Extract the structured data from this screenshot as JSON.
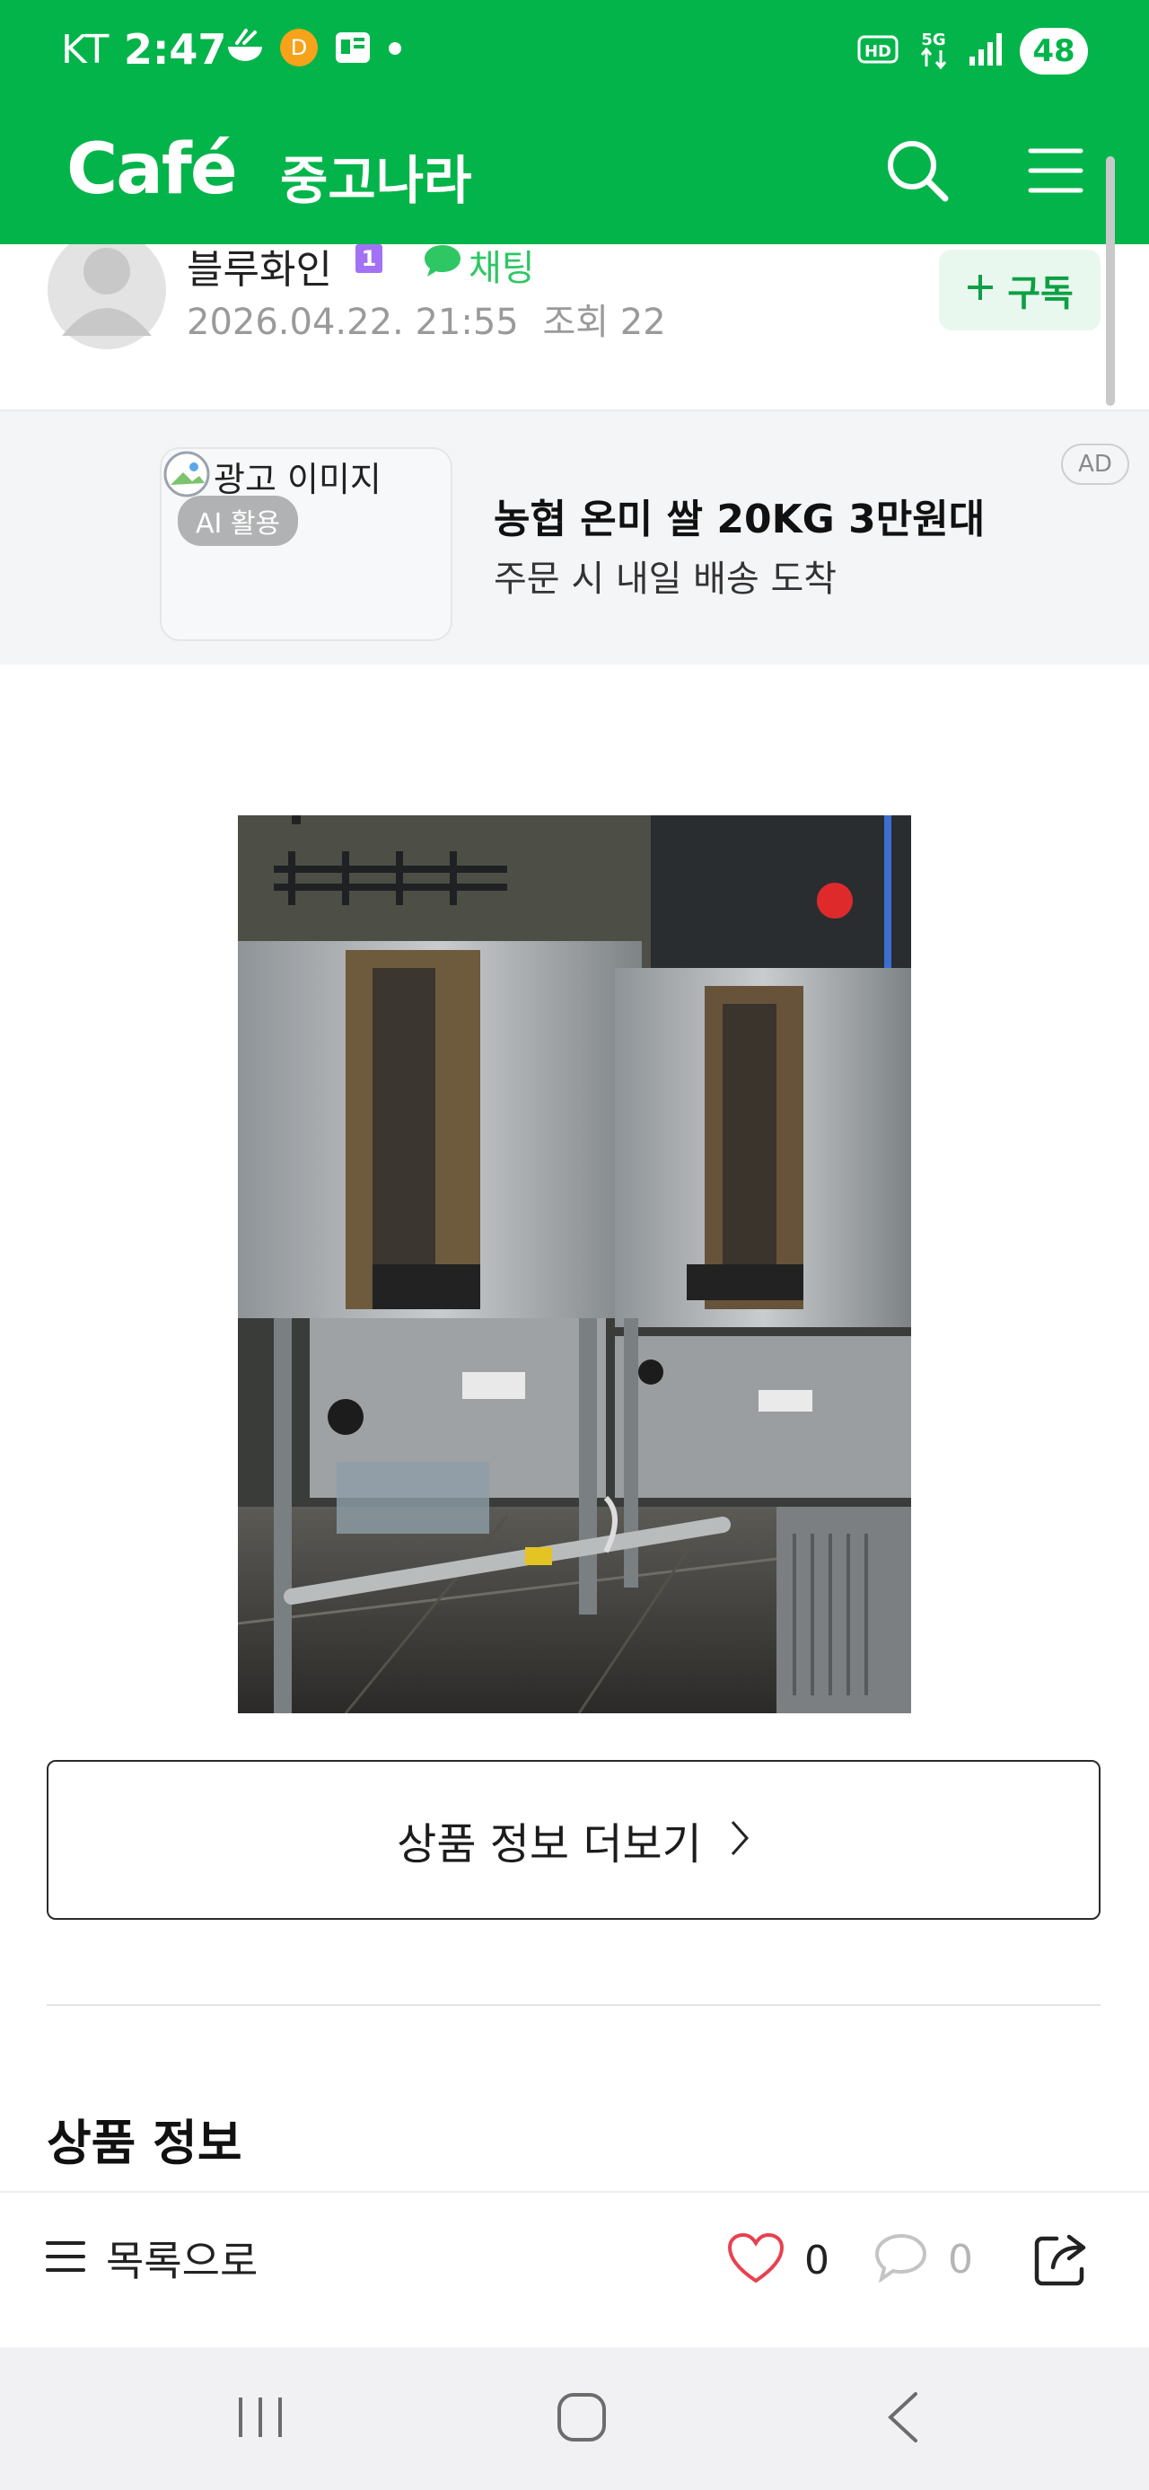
{
  "status_bar": {
    "carrier": "KT",
    "time": "2:47",
    "battery": "48",
    "network": "5G",
    "hd_badge": "HD"
  },
  "header": {
    "logo": "Café",
    "cafe_name": "중고나라",
    "icons": [
      "search-icon",
      "menu-icon"
    ],
    "brand_color": "#03b44a"
  },
  "author": {
    "name": "블루화인",
    "level": "1",
    "chat_label": "채팅",
    "date": "2026.04.22. 21:55",
    "views": "조회 22",
    "subscribe_label": "구독"
  },
  "ad": {
    "image_alt": "광고 이미지",
    "ai_chip": "AI 활용",
    "title": "농협 온미 쌀 20KG 3만원대",
    "subtitle": "주문 시 내일 배송 도착",
    "tag": "AD"
  },
  "product": {
    "more_button": "상품 정보 더보기",
    "section_title": "상품 정보"
  },
  "bottom_bar": {
    "list_label": "목록으로",
    "likes": "0",
    "comments": "0",
    "accent_like": "#e8414f"
  },
  "nav": {
    "icons": [
      "recent-apps-icon",
      "home-icon",
      "back-icon"
    ]
  }
}
